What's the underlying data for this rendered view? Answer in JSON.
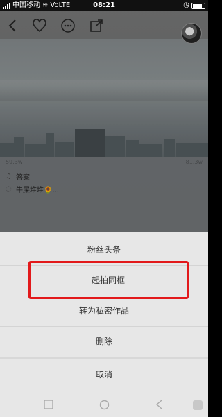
{
  "status_bar": {
    "carrier": "中国移动",
    "network": "VoLTE",
    "time": "08:21"
  },
  "nav": {
    "back_icon": "chevron-left-icon",
    "like_icon": "heart-icon",
    "more_icon": "more-dots-icon",
    "share_icon": "share-icon"
  },
  "post": {
    "views": "59.3w",
    "likes": "81.3w",
    "music_title": "答案",
    "music_author": "牛屎堆堆🌻..."
  },
  "action_sheet": {
    "items": [
      "粉丝头条",
      "一起拍同框",
      "转为私密作品",
      "删除"
    ],
    "cancel": "取消",
    "highlight_color": "#e2191b"
  },
  "system_nav": {
    "icons": [
      "square-icon",
      "circle-icon",
      "triangle-back-icon",
      "handle-icon"
    ]
  }
}
